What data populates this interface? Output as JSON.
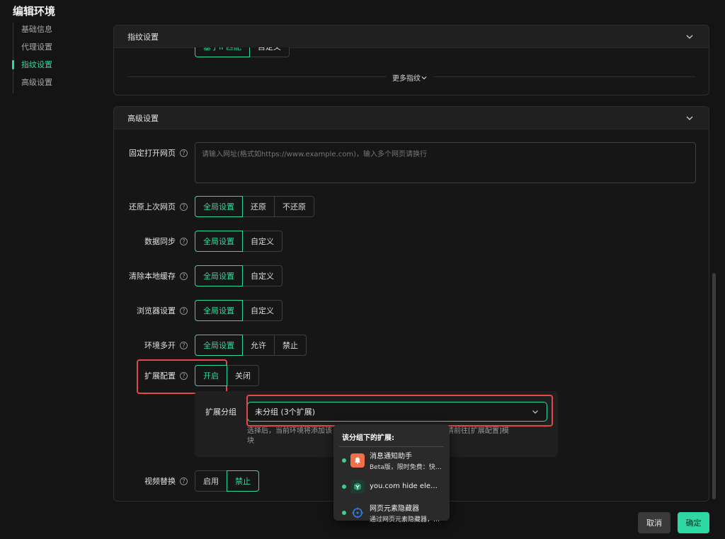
{
  "page": {
    "title": "编辑环境"
  },
  "nav": {
    "items": [
      {
        "label": "基础信息"
      },
      {
        "label": "代理设置"
      },
      {
        "label": "指纹设置"
      },
      {
        "label": "高级设置"
      }
    ],
    "active_index": 2
  },
  "fingerprint_card": {
    "title": "指纹设置",
    "partial_options": [
      "基于IP匹配",
      "自定义"
    ],
    "more_label": "更多指纹"
  },
  "advanced_card": {
    "title": "高级设置",
    "fixed_page": {
      "label": "固定打开网页",
      "placeholder": "请输入网址(格式如https://www.example.com)，输入多个网页请换行"
    },
    "restore_page": {
      "label": "还原上次网页",
      "options": [
        "全局设置",
        "还原",
        "不还原"
      ],
      "selected": 0
    },
    "data_sync": {
      "label": "数据同步",
      "options": [
        "全局设置",
        "自定义"
      ],
      "selected": 0
    },
    "clear_cache": {
      "label": "清除本地缓存",
      "options": [
        "全局设置",
        "自定义"
      ],
      "selected": 0
    },
    "browser_settings": {
      "label": "浏览器设置",
      "options": [
        "全局设置",
        "自定义"
      ],
      "selected": 0
    },
    "multi_open": {
      "label": "环境多开",
      "options": [
        "全局设置",
        "允许",
        "禁止"
      ],
      "selected": 0
    },
    "extension_config": {
      "label": "扩展配置",
      "options": [
        "开启",
        "关闭"
      ],
      "selected": 0
    },
    "extension_group": {
      "label": "扩展分组",
      "value": "未分组 (3个扩展)",
      "hint": "选择后，当前环境将添加该分组下的全部扩展，如需管理扩展，请前往[扩展配置]模块",
      "hint_visible_left": "选择后，当前环境将添加该",
      "hint_visible_right": "扩展，请前往[扩展配置]模",
      "hint_visible_line2": "块"
    },
    "video_replace": {
      "label": "视频替换",
      "options": [
        "启用",
        "禁止"
      ],
      "selected": 1
    }
  },
  "popover": {
    "title": "该分组下的扩展:",
    "items": [
      {
        "name": "消息通知助手",
        "desc": "Beta版，限时免费：快速查看消息通知",
        "icon": "bell-icon",
        "color": "#f0704a"
      },
      {
        "name": "you.com hide elements",
        "desc": "",
        "icon": "cube-icon",
        "color": "#2b8f64"
      },
      {
        "name": "网页元素隐藏器",
        "desc": "通过网页元素隐藏器，隐藏不想看到的元素",
        "icon": "target-icon",
        "color": "#2d7fe0"
      }
    ]
  },
  "footer": {
    "cancel_label": "取消",
    "ok_label": "确定"
  },
  "colors": {
    "accent": "#2ed8a3",
    "highlight": "#e24848",
    "background": "#141414"
  }
}
